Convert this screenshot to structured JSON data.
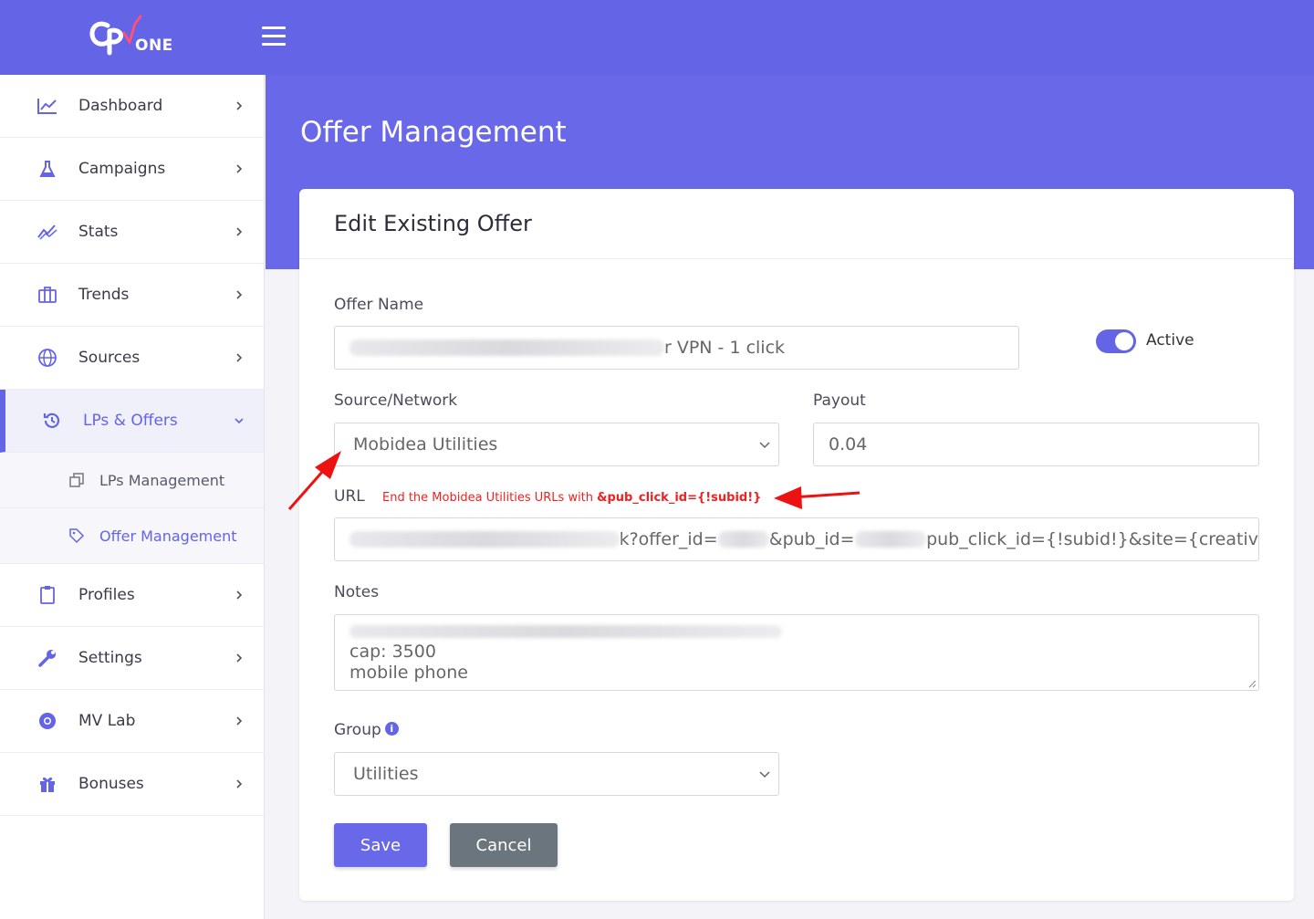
{
  "brand": {
    "logo_text": "ONE"
  },
  "sidebar": {
    "items": [
      {
        "label": "Dashboard",
        "icon": "chart-line-icon"
      },
      {
        "label": "Campaigns",
        "icon": "flask-icon"
      },
      {
        "label": "Stats",
        "icon": "trend-icon"
      },
      {
        "label": "Trends",
        "icon": "briefcase-icon"
      },
      {
        "label": "Sources",
        "icon": "globe-icon"
      },
      {
        "label": "LPs & Offers",
        "icon": "history-icon",
        "active": true
      },
      {
        "label": "Profiles",
        "icon": "clipboard-icon"
      },
      {
        "label": "Settings",
        "icon": "wrench-icon"
      },
      {
        "label": "MV Lab",
        "icon": "chrome-icon"
      },
      {
        "label": "Bonuses",
        "icon": "gift-icon"
      }
    ],
    "sub_items": [
      {
        "label": "LPs Management",
        "icon": "copy-icon"
      },
      {
        "label": "Offer Management",
        "icon": "tag-icon",
        "active": true
      }
    ]
  },
  "page": {
    "title": "Offer Management"
  },
  "card": {
    "title": "Edit Existing Offer",
    "offer_name": {
      "label": "Offer Name",
      "value_visible": "r VPN - 1 click"
    },
    "status": {
      "label": "Active",
      "on": true
    },
    "source": {
      "label": "Source/Network",
      "value": "Mobidea Utilities"
    },
    "payout": {
      "label": "Payout",
      "value": "0.04"
    },
    "url": {
      "label": "URL",
      "hint_prefix": "End the Mobidea Utilities URLs with ",
      "hint_bold": "&pub_click_id={!subid!}",
      "value_part1": "k?offer_id=",
      "value_part2": "&pub_id=",
      "value_part3": "pub_click_id={!subid!}&site={creativ"
    },
    "notes": {
      "label": "Notes",
      "line2": "cap: 3500",
      "line3": "mobile phone"
    },
    "group": {
      "label": "Group",
      "value": "Utilities"
    },
    "buttons": {
      "save": "Save",
      "cancel": "Cancel"
    }
  },
  "colors": {
    "accent": "#6464e6",
    "annotation": "#ee1111",
    "cancel": "#6b757d"
  }
}
